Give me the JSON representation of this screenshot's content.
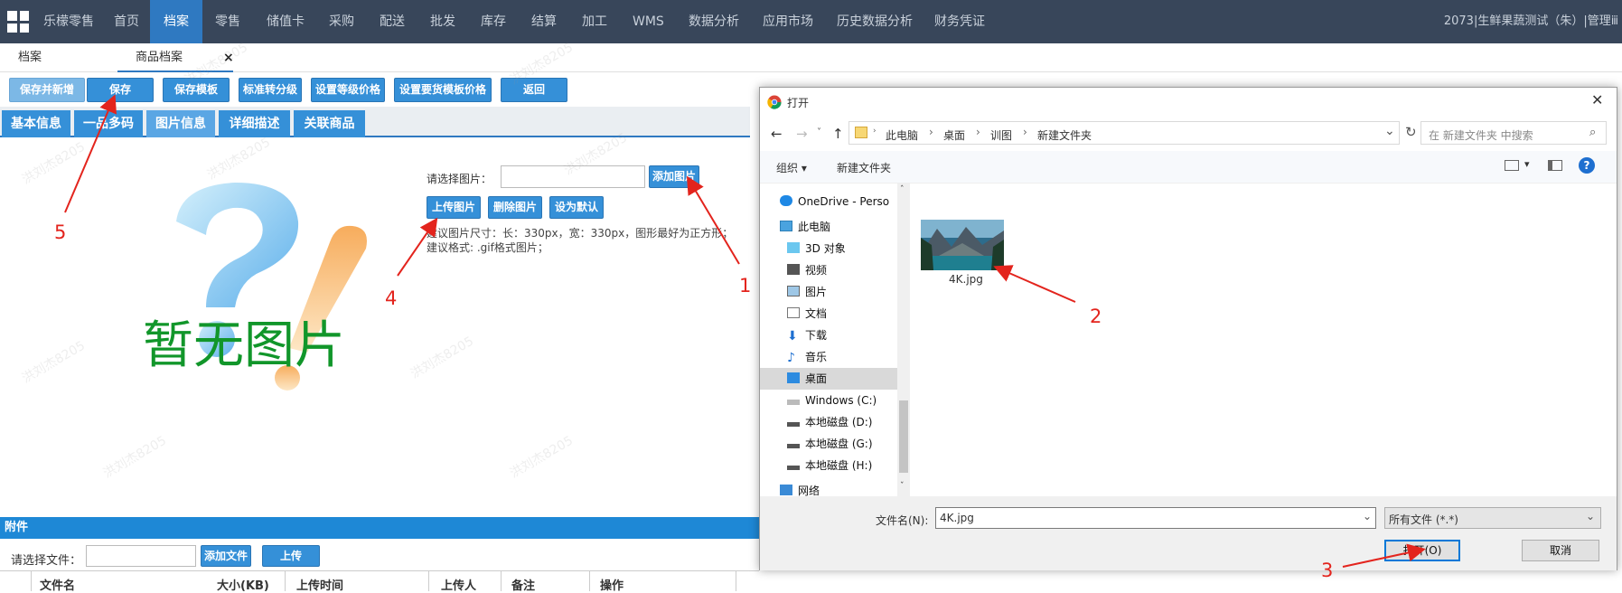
{
  "app": {
    "name": "乐檬零售",
    "nav": [
      "首页",
      "档案",
      "零售",
      "储值卡",
      "采购",
      "配送",
      "批发",
      "库存",
      "结算",
      "加工",
      "WMS",
      "数据分析",
      "应用市场",
      "历史数据分析",
      "财务凭证"
    ],
    "user": "2073|生鲜果蔬测试（朱）|管理ⅲ"
  },
  "tabs": {
    "tab1": "档案",
    "tab2": "商品档案",
    "close": "×"
  },
  "toolbar": [
    "保存并新增",
    "保存",
    "保存模板",
    "标准转分级",
    "设置等级价格",
    "设置要货模板价格",
    "返回"
  ],
  "info_tabs": [
    "基本信息",
    "一品多码",
    "图片信息",
    "详细描述",
    "关联商品"
  ],
  "image_panel": {
    "placeholder_text": "暂无图片",
    "select_label": "请选择图片：",
    "add_button": "添加图片",
    "upload_button": "上传图片",
    "delete_button": "删除图片",
    "default_button": "设为默认",
    "hint_size": "建议图片尺寸：长：330px，宽：330px，图形最好为正方形；",
    "hint_format": "建议格式: .gif格式图片；"
  },
  "attachments": {
    "title": "附件",
    "file_label": "请选择文件：",
    "add_button": "添加文件",
    "upload_button": "上传",
    "columns": [
      "文件名",
      "大小(KB)",
      "上传时间",
      "上传人",
      "备注",
      "操作"
    ]
  },
  "dialog": {
    "title": "打开",
    "close": "✕",
    "breadcrumb": [
      "此电脑",
      "桌面",
      "训图",
      "新建文件夹"
    ],
    "search_placeholder": "在 新建文件夹 中搜索",
    "organize": "组织",
    "new_folder": "新建文件夹",
    "tree": [
      "OneDrive - Perso",
      "此电脑",
      "3D 对象",
      "视频",
      "图片",
      "文档",
      "下载",
      "音乐",
      "桌面",
      "Windows  (C:)",
      "本地磁盘 (D:)",
      "本地磁盘 (G:)",
      "本地磁盘 (H:)",
      "网络"
    ],
    "file_name_item": "4K.jpg",
    "filename_label": "文件名(N):",
    "filename_value": "4K.jpg",
    "filetype": "所有文件 (*.*)",
    "open_button": "打开(O)",
    "cancel_button": "取消"
  },
  "annotations": [
    "1",
    "2",
    "3",
    "4",
    "5"
  ],
  "watermark": "洪刘杰8205",
  "colors": {
    "nav_bg": "#38465a",
    "accent": "#2f79c1",
    "button": "#3590d8",
    "annotation": "#e3241d"
  }
}
